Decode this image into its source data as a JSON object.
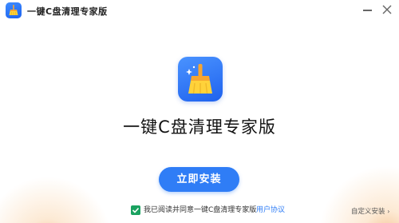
{
  "window": {
    "title": "一键C盘清理专家版",
    "controls": {
      "minimize": "minimize-icon",
      "close": "close-icon"
    }
  },
  "hero": {
    "icon": "broom-icon",
    "product_name": "一键C盘清理专家版"
  },
  "install_button": {
    "label": "立即安装"
  },
  "agreement": {
    "checked": true,
    "text": "我已阅读并同意一键C盘清理专家版",
    "link_label": "用户协议"
  },
  "custom_install": {
    "label": "自定义安装",
    "chevron": "›"
  },
  "colors": {
    "accent": "#2f7df6",
    "checkbox": "#1aa260",
    "icon_gradient_start": "#4a93ff",
    "icon_gradient_end": "#1f62ee",
    "corner_glow": "#f7c79a"
  }
}
